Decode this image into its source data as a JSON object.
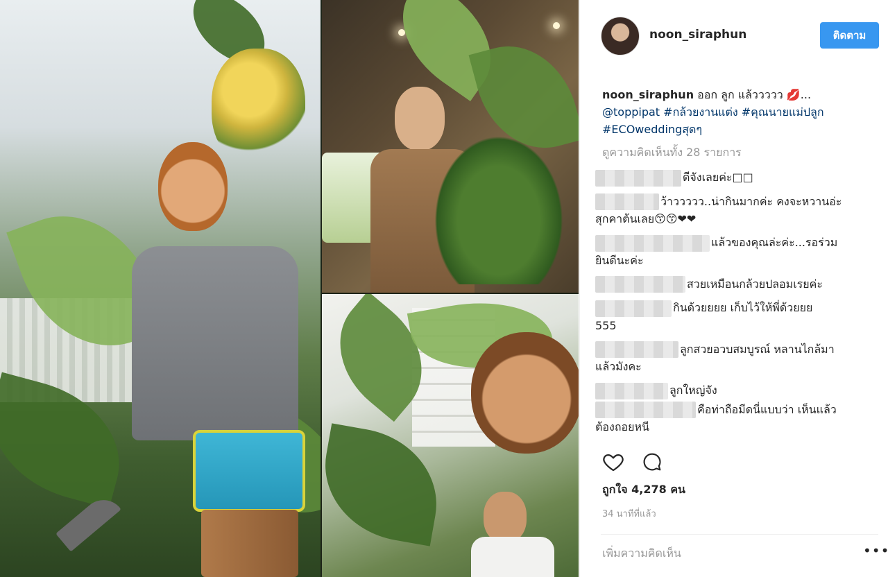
{
  "post": {
    "username": "noon_siraphun",
    "follow_label": "ติดตาม",
    "caption": {
      "username": "noon_siraphun",
      "text": " ออก ลูก แล้ววววว 💋...",
      "mention": "@toppipat",
      "hashtag1": "#กล้วยงานแต่ง",
      "hashtag2": "#คุณนายแม่ปลูก",
      "hashtag3": "#ECOweddingสุดๆ"
    },
    "view_all_comments": "ดูความคิดเห็นทั้ง 28 รายการ",
    "comments": [
      {
        "line1": "ดีจังเลยค่ะ□□",
        "line2": ""
      },
      {
        "line1": "ว้าววววว..น่ากินมากค่ะ คงจะหวานอ่ะ",
        "line2": "สุกคาต้นเลย😙😙❤❤"
      },
      {
        "line1": "แล้วของคุณล่ะค่ะ...รอร่วม",
        "line2": "ยินดีนะค่ะ"
      },
      {
        "line1": "สวยเหมือนกล้วยปลอมเรยค่ะ",
        "line2": ""
      },
      {
        "line1": "กินด้วยยยย เก็บไว้ให้พี่ด้วยยย",
        "line2": "555"
      },
      {
        "line1": "ลูกสวยอวบสมบูรณ์ หลานไกล้มา",
        "line2": "แล้วมังคะ"
      },
      {
        "line1": "ลูกใหญ่จัง",
        "line2": ""
      },
      {
        "line1": "คือท่าถือมีดนี่แบบว่า เห็นแล้ว",
        "line2": "ต้องถอยหนี"
      }
    ],
    "likes": "ถูกใจ 4,278 คน",
    "time_ago": "34 นาทีที่แล้ว",
    "add_comment_placeholder": "เพิ่มความคิดเห็น",
    "more_label": "•••"
  },
  "colors": {
    "accent": "#3897f0",
    "hashtag": "#003569",
    "muted": "#999999"
  },
  "icons": [
    "heart-icon",
    "comment-icon",
    "more-options-icon"
  ]
}
